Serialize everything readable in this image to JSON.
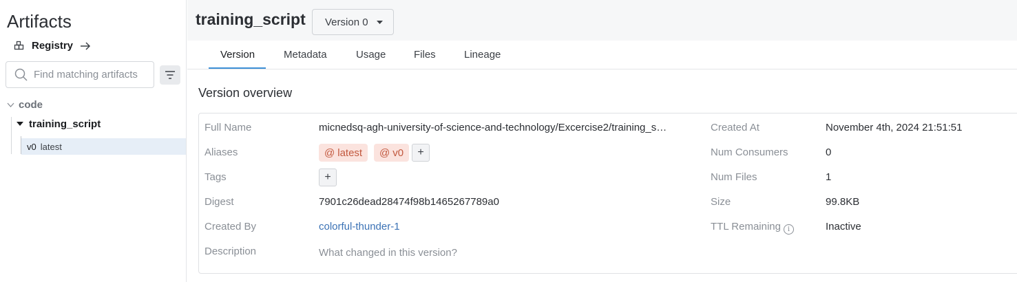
{
  "sidebar": {
    "title": "Artifacts",
    "registry_label": "Registry",
    "search_placeholder": "Find matching artifacts",
    "group": "code",
    "artifact": "training_script",
    "version": {
      "id": "v0",
      "alias": "latest"
    }
  },
  "header": {
    "title": "training_script",
    "version_select": "Version 0"
  },
  "tabs": [
    "Version",
    "Metadata",
    "Usage",
    "Files",
    "Lineage"
  ],
  "overview": {
    "title": "Version overview",
    "left": {
      "full_name_label": "Full Name",
      "full_name": "micnedsq-agh-university-of-science-and-technology/Excercise2/training_s…",
      "aliases_label": "Aliases",
      "aliases": [
        "latest",
        "v0"
      ],
      "tags_label": "Tags",
      "digest_label": "Digest",
      "digest": "7901c26dead28474f98b1465267789a0",
      "created_by_label": "Created By",
      "created_by": "colorful-thunder-1",
      "description_label": "Description",
      "description_placeholder": "What changed in this version?"
    },
    "right": {
      "created_at_label": "Created At",
      "created_at": "November 4th, 2024 21:51:51",
      "num_consumers_label": "Num Consumers",
      "num_consumers": "0",
      "num_files_label": "Num Files",
      "num_files": "1",
      "size_label": "Size",
      "size": "99.8KB",
      "ttl_label": "TTL Remaining",
      "ttl": "Inactive"
    }
  },
  "icons": {
    "at_symbol": "@",
    "plus": "+",
    "info": "i"
  },
  "colors": {
    "accent": "#3d8fd6",
    "link": "#3b72b5",
    "alias_bg": "#fbe3de",
    "alias_text": "#c2593f",
    "selected_row": "#e6eef7"
  }
}
